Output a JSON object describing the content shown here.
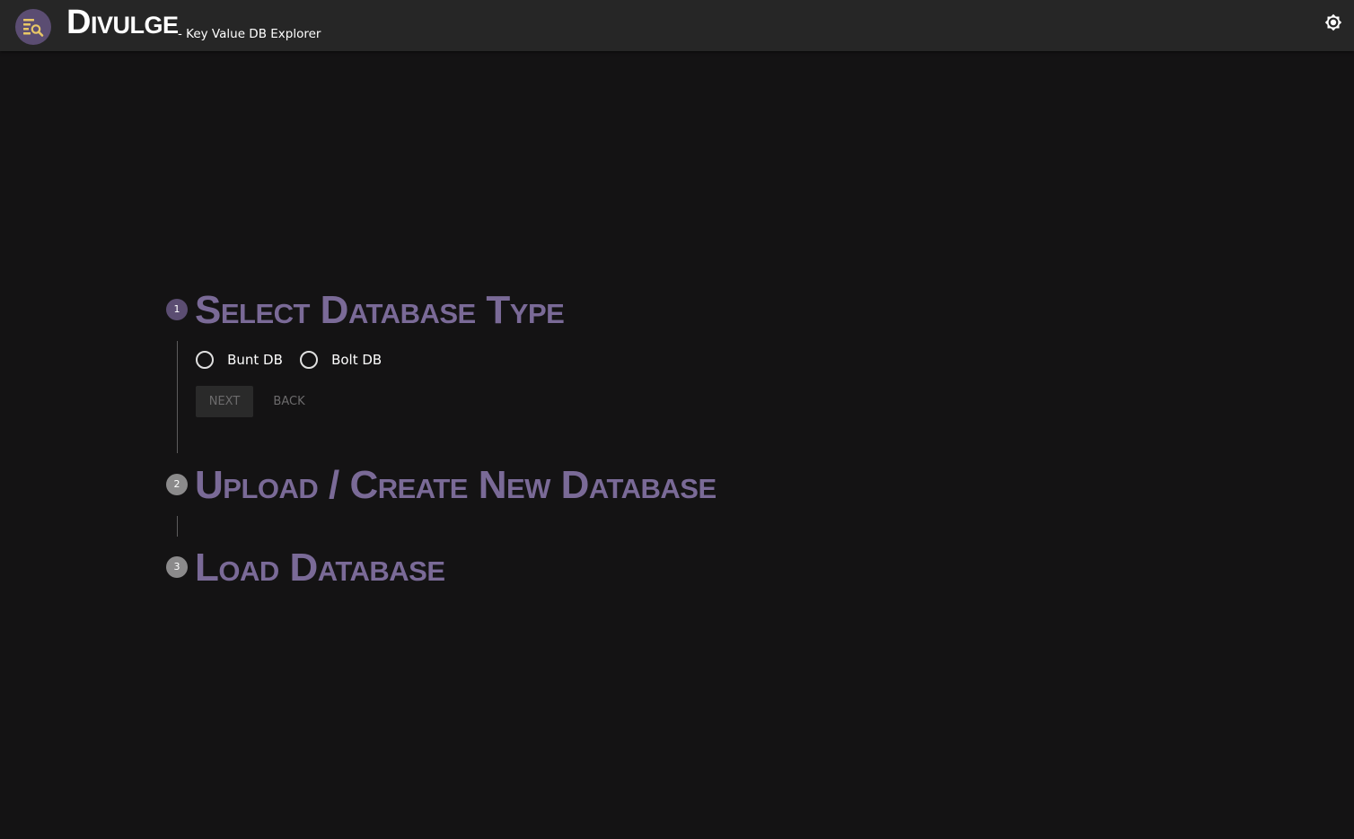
{
  "app": {
    "title": "Divulge",
    "subtitle": "- Key Value DB Explorer",
    "logo_icon": "database-search-icon",
    "theme_toggle_icon": "brightness-icon"
  },
  "colors": {
    "appbar_bg": "#262626",
    "page_bg": "#141314",
    "accent": "#5b4d72",
    "step_title": "#7a6a97",
    "logo_yellow": "#e8c766"
  },
  "stepper": {
    "steps": [
      {
        "number": "1",
        "title": "Select Database Type",
        "state": "active"
      },
      {
        "number": "2",
        "title": "Upload / Create New Database",
        "state": "inactive"
      },
      {
        "number": "3",
        "title": "Load Database",
        "state": "inactive"
      }
    ],
    "db_options": [
      {
        "label": "Bunt DB",
        "selected": false
      },
      {
        "label": "Bolt DB",
        "selected": false
      }
    ],
    "next_label": "NEXT",
    "back_label": "BACK"
  }
}
